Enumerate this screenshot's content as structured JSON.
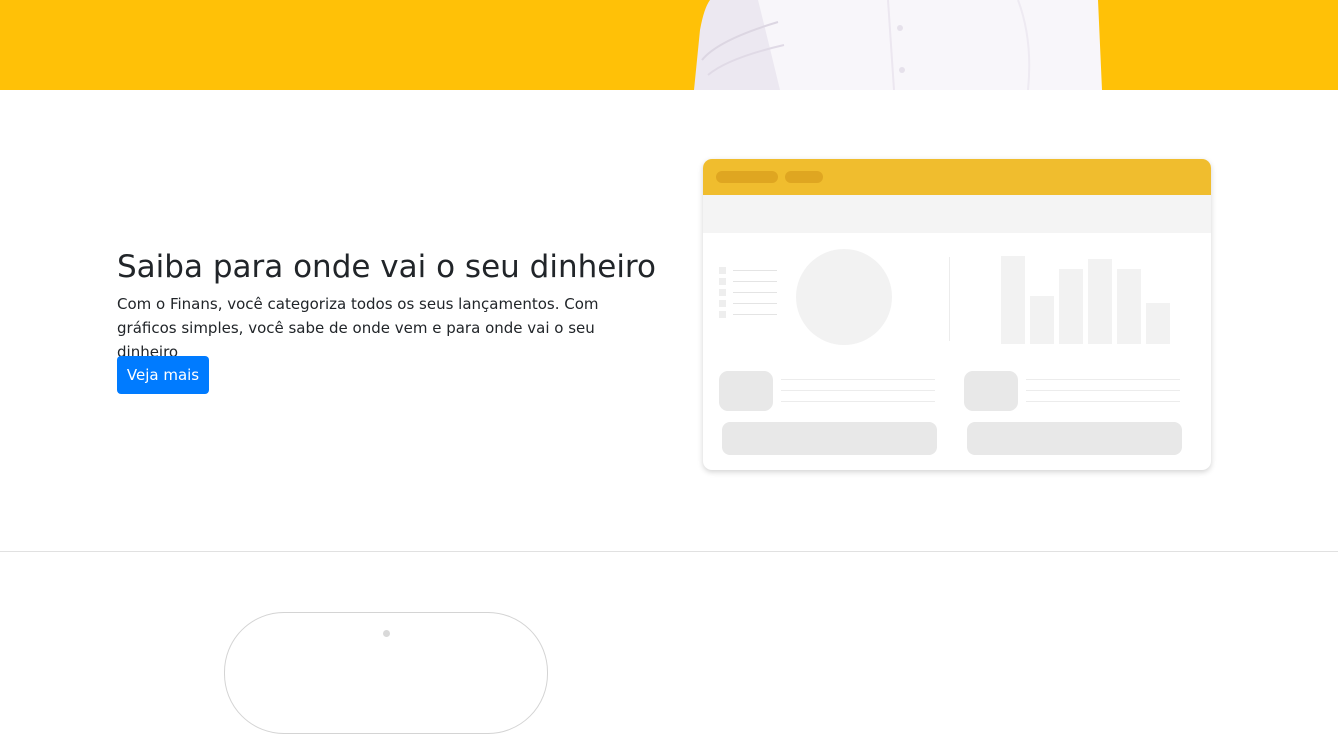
{
  "hero": {
    "band_color": "#ffc107"
  },
  "feature": {
    "title": "Saiba para onde vai o seu dinheiro",
    "description": "Com o Finans, você categoriza todos os seus lançamentos. Com gráficos simples, você sabe de onde vem e para onde vai o seu dinheiro",
    "button_label": "Veja mais",
    "button_color": "#007bff"
  },
  "dashboard_illustration": {
    "header_color": "#f0bd2e",
    "bar_levels": [
      1.0,
      0.55,
      0.85,
      0.97,
      0.85,
      0.47
    ]
  }
}
